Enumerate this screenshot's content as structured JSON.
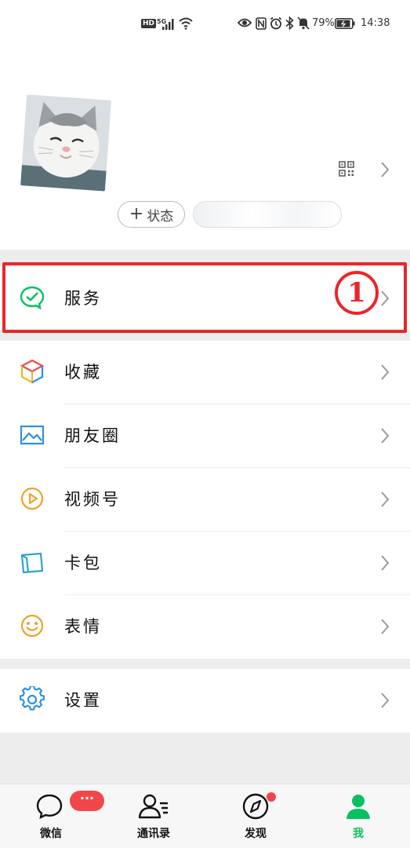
{
  "status_bar": {
    "hd": "HD",
    "network": "5G",
    "battery": "79%",
    "time": "14:38"
  },
  "profile": {
    "status_button": "状态"
  },
  "menu": {
    "service": "服务",
    "favorites": "收藏",
    "moments": "朋友圈",
    "channels": "视频号",
    "cards": "卡包",
    "stickers": "表情",
    "settings": "设置"
  },
  "annotation": {
    "step": "1"
  },
  "tabs": {
    "chats": "微信",
    "chats_badge": "···",
    "contacts": "通讯录",
    "discover": "发现",
    "me": "我"
  },
  "colors": {
    "accent_green": "#07c160",
    "highlight_red": "#e8262b",
    "badge_red": "#f2474a"
  }
}
